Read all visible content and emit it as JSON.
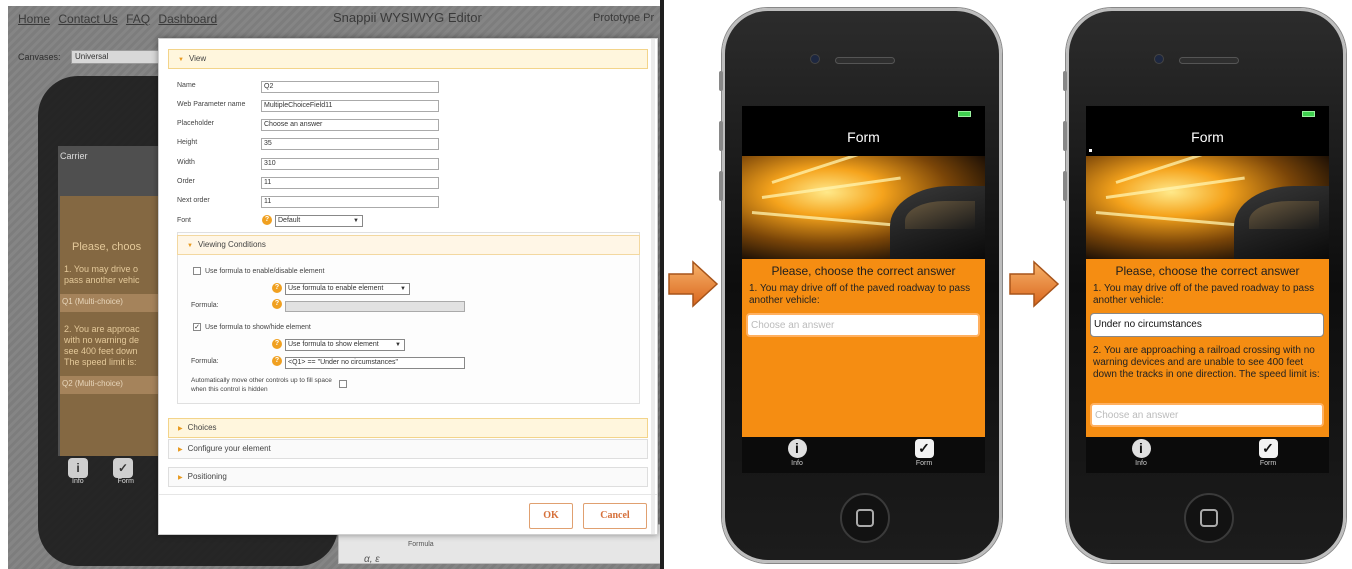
{
  "editor": {
    "nav": [
      "Home",
      "Contact Us",
      "FAQ",
      "Dashboard"
    ],
    "app_title": "Snappii WYSIWYG Editor",
    "prototype_label": "Prototype Pr",
    "canvases_label": "Canvases:",
    "canvases_value": "Universal",
    "background_phone": {
      "carrier": "Carrier",
      "question_title": "Please, choos",
      "q1_text": "1. You may drive o\npass another vehic",
      "q1_field": "Q1 (Multi-choice)",
      "q2_text": "2. You are approac\nwith no warning de\nsee 400 feet down\nThe speed limit is:",
      "q2_field": "Q2 (Multi-choice)",
      "tab_info": "Info",
      "tab_form": "Form",
      "formula_label": "Formula",
      "formula_symbol": "α, ε"
    },
    "modal": {
      "view_section": "View",
      "fields": [
        {
          "label": "Name",
          "value": "Q2"
        },
        {
          "label": "Web Parameter name",
          "value": "MultipleChoiceField11"
        },
        {
          "label": "Placeholder",
          "value": "Choose an answer"
        },
        {
          "label": "Height",
          "value": "35"
        },
        {
          "label": "Width",
          "value": "310"
        },
        {
          "label": "Order",
          "value": "11"
        },
        {
          "label": "Next order",
          "value": "11"
        }
      ],
      "font_label": "Font",
      "font_value": "Default",
      "viewing_conditions": "Viewing Conditions",
      "enable_checkbox_label": "Use formula to enable/disable element",
      "enable_checked": false,
      "enable_select": "Use formula to enable element",
      "formula_label": "Formula:",
      "show_checkbox_label": "Use formula to show/hide element",
      "show_checked": true,
      "show_select": "Use formula to show element",
      "show_formula_value": "<Q1> == \"Under no circumstances\"",
      "auto_move_label": "Automatically move other controls up to fill space when this control is hidden",
      "auto_move_checked": false,
      "choices_section": "Choices",
      "configure_section": "Configure your element",
      "positioning_section": "Positioning",
      "ok_label": "OK",
      "cancel_label": "Cancel"
    }
  },
  "phone_before": {
    "nav_title": "Form",
    "question_title": "Please, choose the correct answer",
    "q1_text": "1. You may drive off of the paved roadway to pass another vehicle:",
    "q1_placeholder": "Choose an answer",
    "tab_info": "Info",
    "tab_form": "Form"
  },
  "phone_after": {
    "nav_title": "Form",
    "question_title": "Please, choose the correct answer",
    "q1_text": "1. You may drive off of the paved roadway to pass another vehicle:",
    "q1_value": "Under no circumstances",
    "q2_text": "2. You are approaching a railroad crossing with no warning devices and are unable to see 400 feet down the tracks in one direction. The speed limit is:",
    "q2_placeholder": "Choose an answer",
    "tab_info": "Info",
    "tab_form": "Form"
  },
  "colors": {
    "accent_orange": "#f58d12",
    "battery_green": "#3fd04f",
    "button_text": "#d6703a"
  },
  "icons": [
    "info-icon",
    "checkmark-icon",
    "arrow-right-icon",
    "help-icon",
    "caret-icon",
    "home-button-icon"
  ]
}
